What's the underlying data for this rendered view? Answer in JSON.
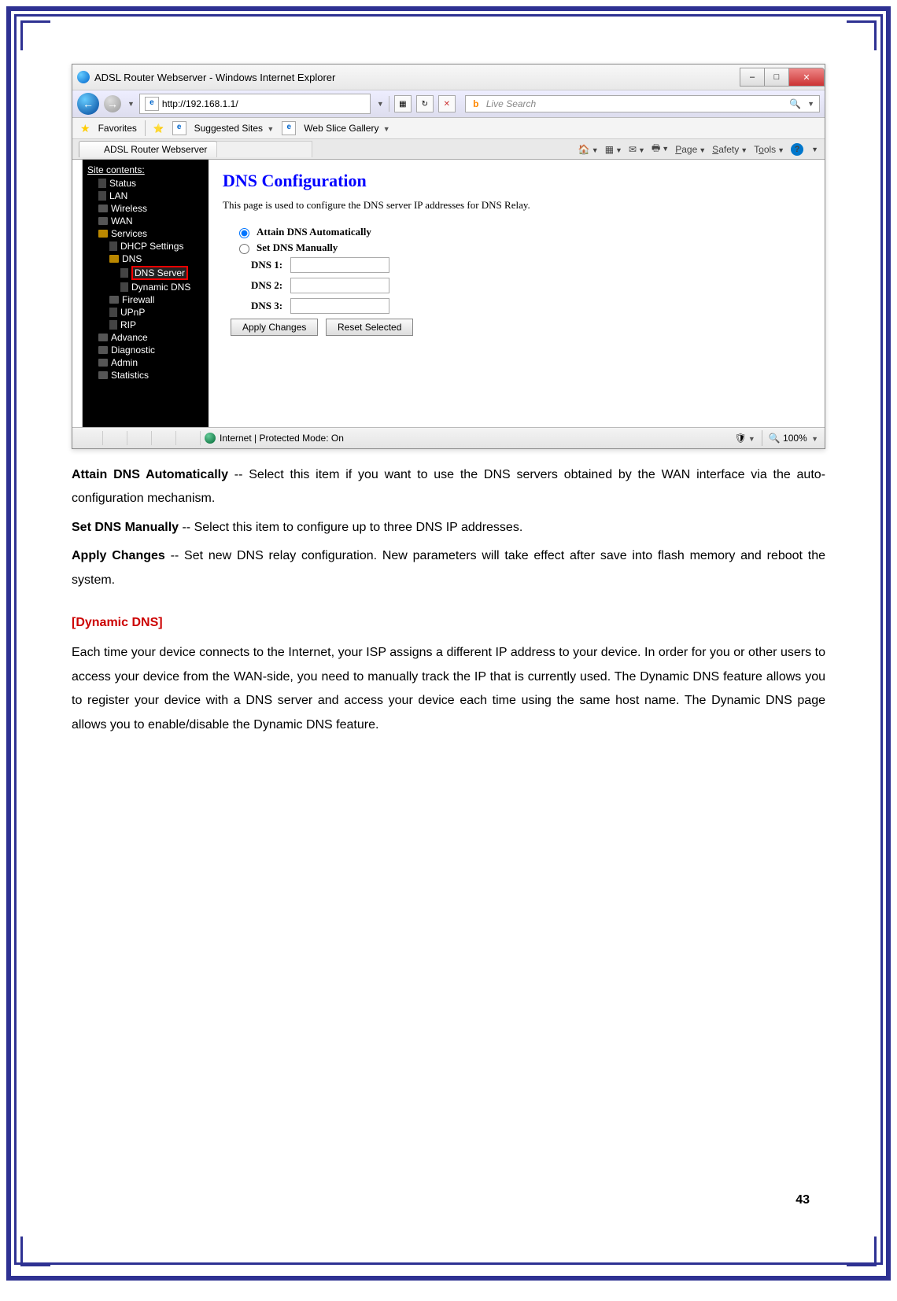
{
  "browser": {
    "title": "ADSL Router Webserver - Windows Internet Explorer",
    "url": "http://192.168.1.1/",
    "search_placeholder": "Live Search",
    "favorites_label": "Favorites",
    "suggested_sites": "Suggested Sites",
    "web_slice": "Web Slice Gallery",
    "tab_title": "ADSL Router Webserver",
    "menu": {
      "page": "Page",
      "safety": "Safety",
      "tools": "Tools"
    },
    "status_text": "Internet | Protected Mode: On",
    "zoom": "100%"
  },
  "sidebar": {
    "header": "Site contents:",
    "items": [
      {
        "label": "Status",
        "indent": 1
      },
      {
        "label": "LAN",
        "indent": 1
      },
      {
        "label": "Wireless",
        "indent": 1
      },
      {
        "label": "WAN",
        "indent": 1
      },
      {
        "label": "Services",
        "indent": 1,
        "open": true
      },
      {
        "label": "DHCP Settings",
        "indent": 2
      },
      {
        "label": "DNS",
        "indent": 2,
        "open": true
      },
      {
        "label": "DNS Server",
        "indent": 3,
        "highlight": true
      },
      {
        "label": "Dynamic DNS",
        "indent": 3
      },
      {
        "label": "Firewall",
        "indent": 2
      },
      {
        "label": "UPnP",
        "indent": 2
      },
      {
        "label": "RIP",
        "indent": 2
      },
      {
        "label": "Advance",
        "indent": 1
      },
      {
        "label": "Diagnostic",
        "indent": 1
      },
      {
        "label": "Admin",
        "indent": 1
      },
      {
        "label": "Statistics",
        "indent": 1
      }
    ]
  },
  "config": {
    "title": "DNS Configuration",
    "desc": "This page is used to configure the DNS server IP addresses for DNS Relay.",
    "radio1": "Attain DNS Automatically",
    "radio2": "Set DNS Manually",
    "dns1": "DNS 1:",
    "dns2": "DNS 2:",
    "dns3": "DNS 3:",
    "btn_apply": "Apply Changes",
    "btn_reset": "Reset Selected"
  },
  "doc": {
    "p1_bold": "Attain DNS Automatically",
    "p1_rest": " -- Select this item if you want to use the DNS servers obtained by the WAN interface via the auto-configuration mechanism.",
    "p2_bold": "Set DNS Manually",
    "p2_rest": " -- Select this item to configure up to three DNS IP addresses.",
    "p3_bold": "Apply Changes",
    "p3_rest": " -- Set new DNS relay configuration. New parameters will take effect after save into flash memory and reboot the system.",
    "section": "[Dynamic DNS]",
    "p4": "Each time your device connects to the Internet, your ISP assigns a different IP address to your device. In order for you or other users to access your device from the WAN-side, you need to manually track the IP that is currently used. The Dynamic DNS feature allows you to register your device with a DNS server and access your device each time using the same host name. The Dynamic DNS page allows you to enable/disable the Dynamic DNS feature."
  },
  "page_number": "43"
}
